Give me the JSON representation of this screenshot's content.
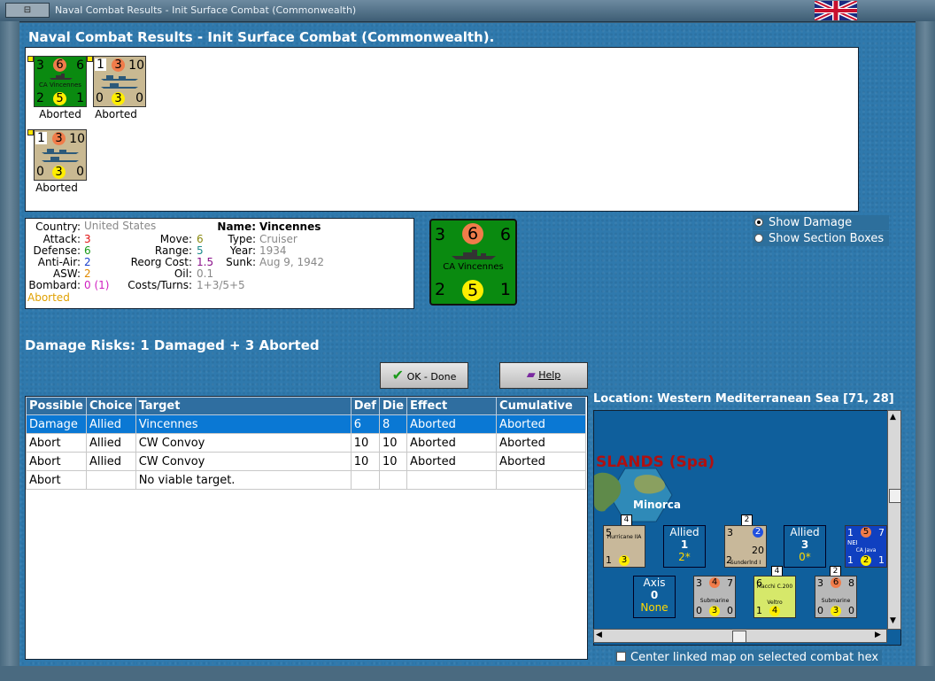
{
  "window": {
    "title": "Naval Combat Results - Init Surface Combat (Commonwealth)",
    "close_label": "⊟"
  },
  "header": {
    "title": "Naval Combat Results - Init Surface Combat (Commonwealth)."
  },
  "results": [
    {
      "top_left": "3",
      "top_mid": "6",
      "top_right": "6",
      "name": "CA Vincennes",
      "bot_left": "2",
      "bot_mid": "5",
      "bot_right": "1",
      "status": "Aborted"
    },
    {
      "top_left": "1",
      "top_mid": "3",
      "top_right": "10",
      "name": "",
      "bot_left": "0",
      "bot_mid": "3",
      "bot_right": "0",
      "status": "Aborted"
    },
    {
      "top_left": "1",
      "top_mid": "3",
      "top_right": "10",
      "name": "",
      "bot_left": "0",
      "bot_mid": "3",
      "bot_right": "0",
      "status": "Aborted"
    }
  ],
  "info": {
    "country_label": "Country:",
    "country": "United States",
    "attack_label": "Attack:",
    "attack": "3",
    "defense_label": "Defense:",
    "defense": "6",
    "antiair_label": "Anti-Air:",
    "antiair": "2",
    "asw_label": "ASW:",
    "asw": "2",
    "bombard_label": "Bombard:",
    "bombard": "0 (1)",
    "status": "Aborted",
    "move_label": "Move:",
    "move": "6",
    "range_label": "Range:",
    "range": "5",
    "reorg_label": "Reorg Cost:",
    "reorg": "1.5",
    "oil_label": "Oil:",
    "oil": "0.1",
    "costs_label": "Costs/Turns:",
    "costs": "1+3/5+5",
    "name_label": "Name:",
    "name": "Vincennes",
    "type_label": "Type:",
    "type": "Cruiser",
    "year_label": "Year:",
    "year": "1934",
    "sunk_label": "Sunk:",
    "sunk": "Aug 9, 1942"
  },
  "big_counter": {
    "tl": "3",
    "tm": "6",
    "tr": "6",
    "name": "CA Vincennes",
    "bl": "2",
    "bm": "5",
    "br": "1"
  },
  "options": {
    "show_damage": "Show Damage",
    "show_section": "Show Section Boxes"
  },
  "damage_risks": "Damage Risks: 1 Damaged + 3 Aborted",
  "buttons": {
    "ok": "OK - Done",
    "help": "Help"
  },
  "table": {
    "headers": [
      "Possible",
      "Choice",
      "Target",
      "Def",
      "Die",
      "Effect",
      "Cumulative"
    ],
    "rows": [
      [
        "Damage",
        "Allied",
        "Vincennes",
        "6",
        "8",
        "Aborted",
        "Aborted"
      ],
      [
        "Abort",
        "Allied",
        "CW Convoy",
        "10",
        "10",
        "Aborted",
        "Aborted"
      ],
      [
        "Abort",
        "Allied",
        "CW Convoy",
        "10",
        "10",
        "Aborted",
        "Aborted"
      ],
      [
        "Abort",
        "",
        "No viable target.",
        "",
        "",
        "",
        ""
      ]
    ]
  },
  "location": "Location:  Western Mediterranean Sea [71, 28]",
  "map": {
    "region": "SLANDS (Spa)",
    "island": "Minorca",
    "stack_count_1": "4",
    "stack_count_2": "2",
    "stack_count_3": "4",
    "stack_count_4": "2",
    "allied_box_1": {
      "title": "Allied",
      "value": "1",
      "sub": "2*"
    },
    "allied_box_2": {
      "title": "Allied",
      "value": "3",
      "sub": "0*"
    },
    "axis_box": {
      "title": "Axis",
      "value": "0",
      "sub": "None"
    },
    "hurricane": {
      "tl": "5",
      "name": "Hurricane IIA",
      "bl": "1",
      "bm": "3"
    },
    "sunderland": {
      "tl": "3",
      "tr": "2",
      "mr": "20",
      "name": "Sunderlnd I",
      "bl": "2"
    },
    "java": {
      "tl": "1",
      "tm": "5",
      "tr": "7",
      "nat": "NEI",
      "name": "CA Java",
      "bl": "1",
      "bm": "2",
      "br": "1"
    },
    "sub1": {
      "tl": "3",
      "tm": "4",
      "tr": "7",
      "name": "Submarine",
      "bl": "0",
      "bm": "3",
      "br": "0"
    },
    "macchi": {
      "tl": "6",
      "name": "Macchi C.200",
      "sub": "Veltro",
      "bl": "1",
      "bm": "4"
    },
    "sub2": {
      "tl": "3",
      "tm": "6",
      "tr": "8",
      "name": "Submarine",
      "bl": "0",
      "bm": "3",
      "br": "0"
    }
  },
  "center_map": "Center linked map on selected combat hex"
}
